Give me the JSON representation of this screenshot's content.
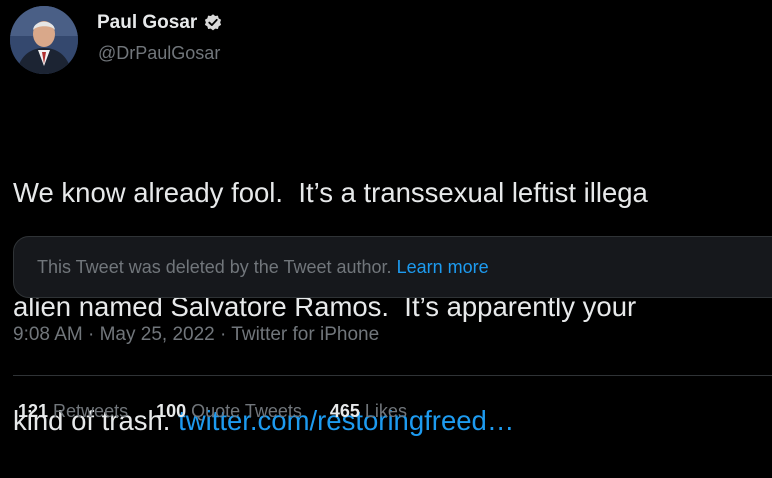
{
  "author": {
    "name": "Paul Gosar",
    "handle": "@DrPaulGosar",
    "verified": true,
    "avatar_icon": "profile-photo-icon",
    "verified_icon": "verified-badge-icon"
  },
  "tweet": {
    "lines": [
      "We know already fool.  It’s a transsexual leftist illega",
      "alien named Salvatore Ramos.  It’s apparently your",
      "kind of trash. "
    ],
    "link_text": "twitter.com/restoringfreed…"
  },
  "quoted": {
    "deleted_text": "This Tweet was deleted by the Tweet author. ",
    "learn_more": "Learn more"
  },
  "meta": {
    "time": "9:08 AM",
    "sep1": " · ",
    "date": "May 25, 2022",
    "sep2": " · ",
    "source": "Twitter for iPhone"
  },
  "stats": {
    "retweets_count": "121",
    "retweets_label": " Retweets",
    "quotes_count": "100",
    "quotes_label": " Quote Tweets",
    "likes_count": "465",
    "likes_label": " Likes"
  },
  "colors": {
    "background": "#000000",
    "text": "#e7e9ea",
    "secondary": "#71767b",
    "link": "#1d9bf0",
    "verified": "#d9d9d9"
  }
}
